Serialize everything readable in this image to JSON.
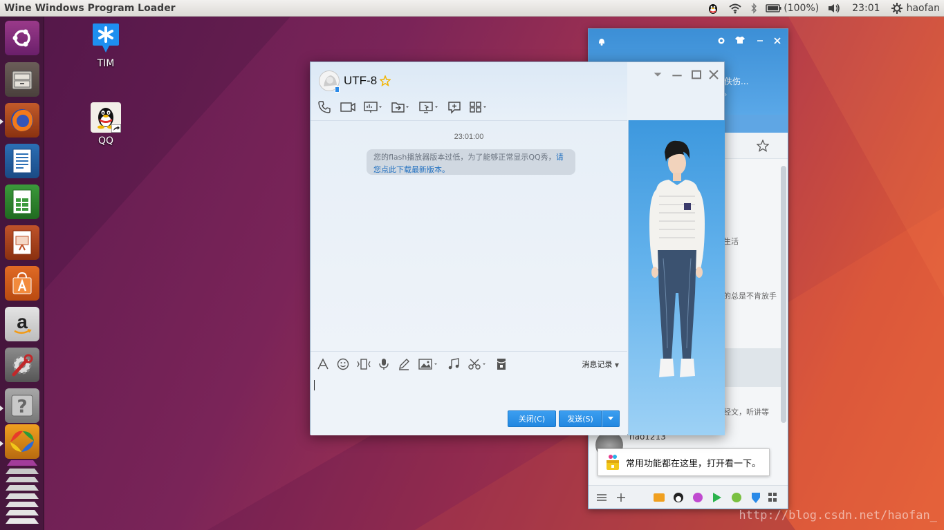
{
  "top_panel": {
    "app_title": "Wine Windows Program Loader",
    "battery": "(100%)",
    "clock": "23:01",
    "user": "haofan"
  },
  "desktop": {
    "icons": [
      {
        "label": "TIM",
        "icon": "tim-icon"
      },
      {
        "label": "QQ",
        "icon": "qq-penguin-icon"
      }
    ]
  },
  "launcher": {
    "items": [
      "ubuntu-dash",
      "files",
      "firefox",
      "libreoffice-writer",
      "libreoffice-calc",
      "libreoffice-impress",
      "ubuntu-software",
      "amazon",
      "system-settings",
      "help",
      "wine",
      "workspaces"
    ]
  },
  "qq_main": {
    "status_partial": "佚伤...",
    "snippets": [
      "生活",
      "的总是不肯放手",
      "经文，听讲等"
    ],
    "contact_name": "hao1213",
    "tip": "常用功能都在这里，打开看一下。"
  },
  "chat": {
    "title": "UTF-8",
    "timestamp": "23:01:00",
    "bubble_text": "您的flash播放器版本过低，为了能够正常显示QQ秀，",
    "bubble_link": "请您点此下载最新版本。",
    "history_label": "消息记录",
    "close_label": "关闭(C)",
    "send_label": "发送(S)"
  },
  "watermark": "http://blog.csdn.net/haofan_"
}
